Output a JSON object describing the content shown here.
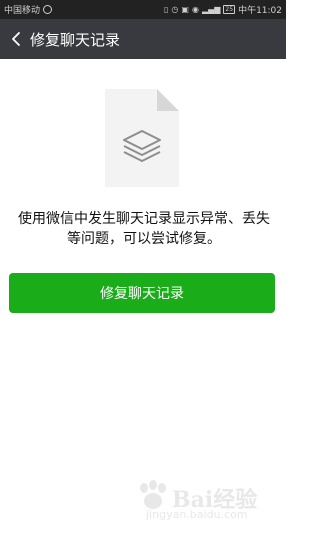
{
  "status_bar": {
    "carrier": "中国移动",
    "battery": "25",
    "time": "中午11:02",
    "icons": [
      "vibrate-icon",
      "alarm-icon",
      "hd-icon",
      "eye-icon",
      "signal-icon",
      "battery-icon"
    ]
  },
  "header": {
    "title": "修复聊天记录",
    "back_icon": "chevron-left-icon"
  },
  "main": {
    "illustration": "document-layers-icon",
    "description": "使用微信中发生聊天记录显示异常、丢失等问题，可以尝试修复。",
    "button_label": "修复聊天记录"
  },
  "watermark": {
    "brand": "Bai经验",
    "url": "jingyan.baidu.com"
  },
  "colors": {
    "titlebar": "#393a3f",
    "status_bar": "#222222",
    "button": "#1aad19",
    "doc_fill": "#f3f3f3"
  }
}
